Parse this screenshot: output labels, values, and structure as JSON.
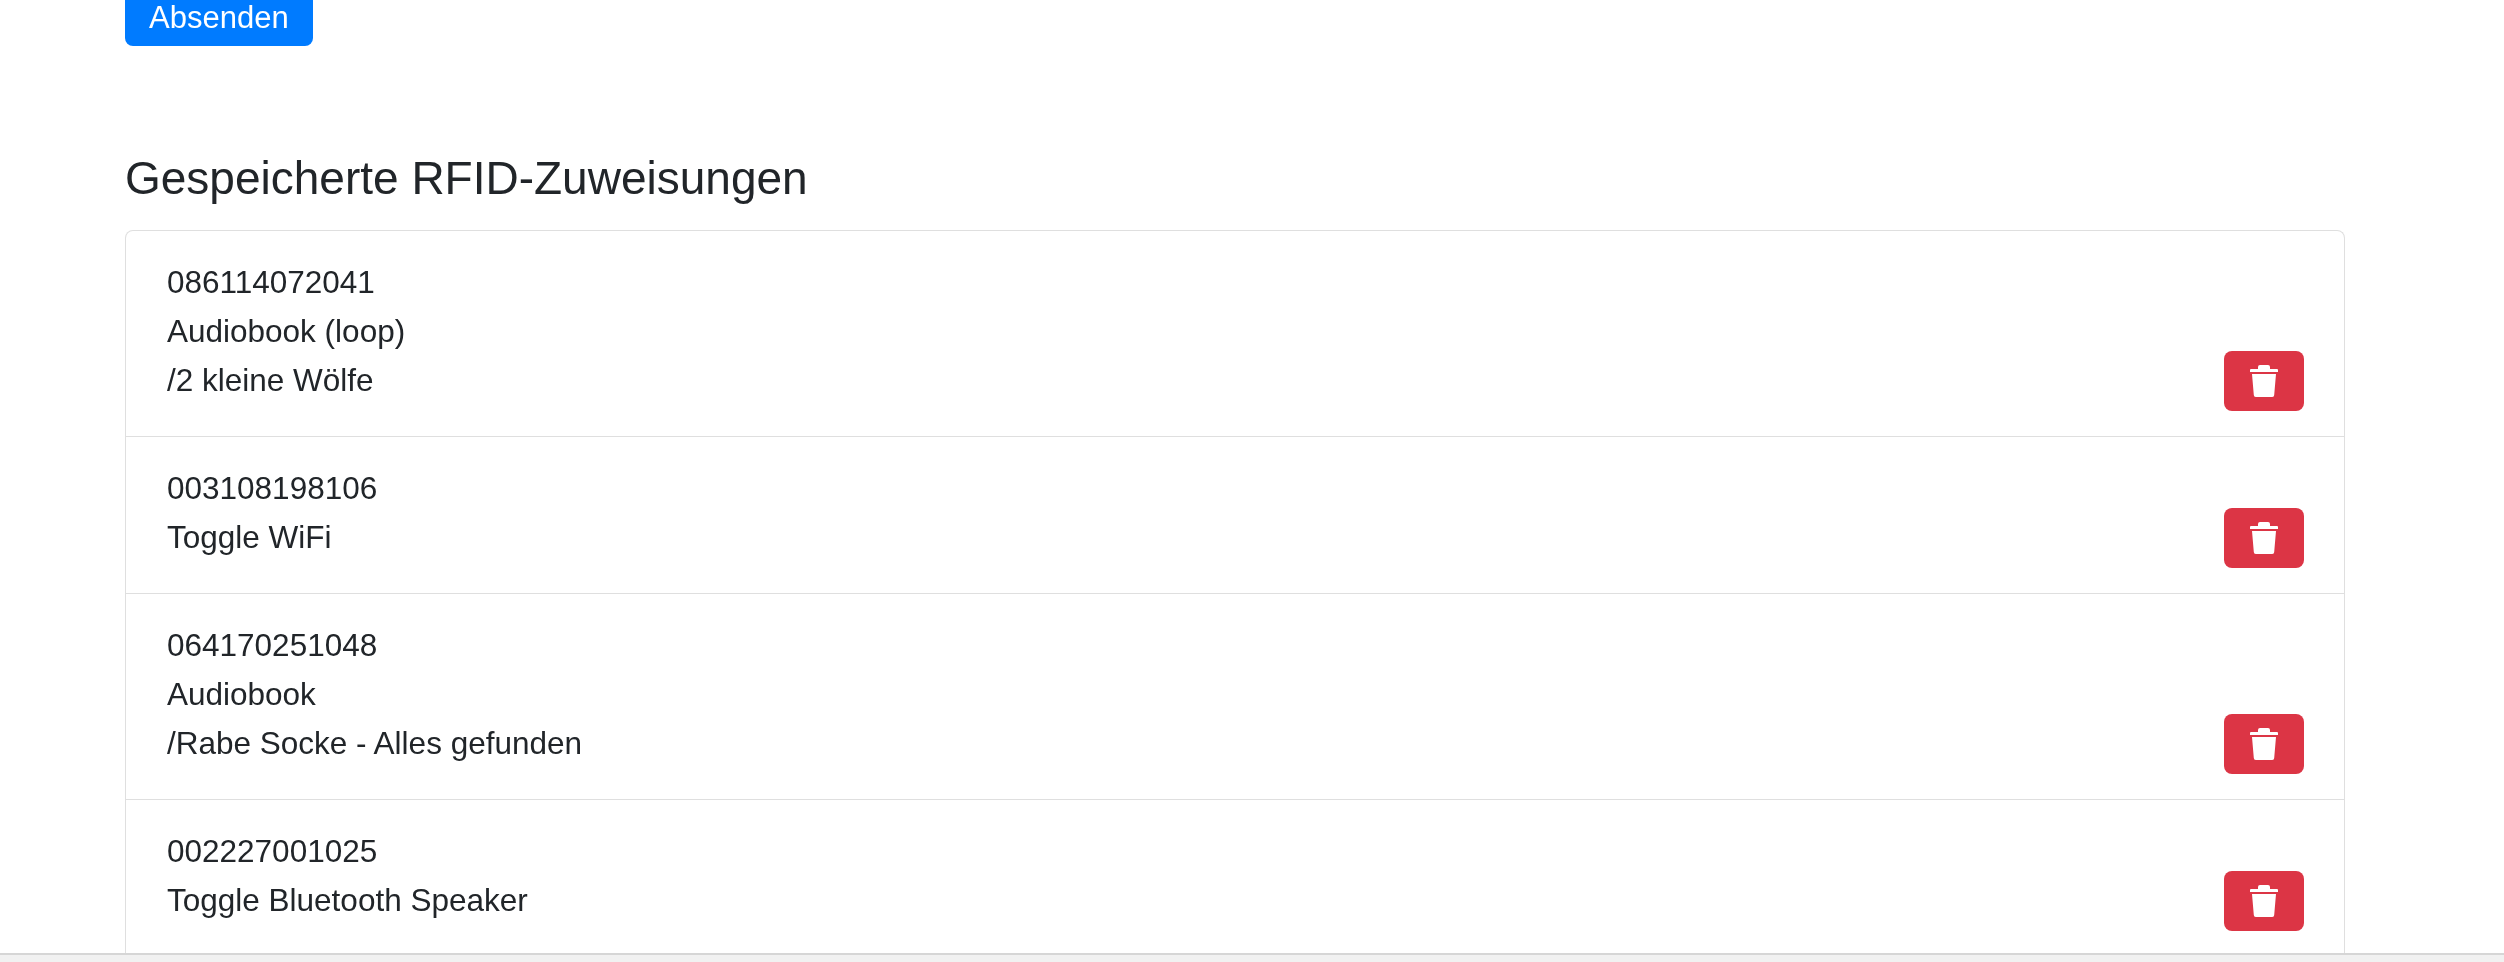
{
  "submit_button": {
    "label": "Absenden"
  },
  "section": {
    "title": "Gespeicherte RFID-Zuweisungen"
  },
  "assignments": [
    {
      "tag_id": "086114072041",
      "action": "Audiobook (loop)",
      "folder": "/2 kleine Wölfe"
    },
    {
      "tag_id": "003108198106",
      "action": "Toggle WiFi"
    },
    {
      "tag_id": "064170251048",
      "action": "Audiobook",
      "folder": "/Rabe Socke - Alles gefunden"
    },
    {
      "tag_id": "002227001025",
      "action": "Toggle Bluetooth Speaker"
    }
  ]
}
